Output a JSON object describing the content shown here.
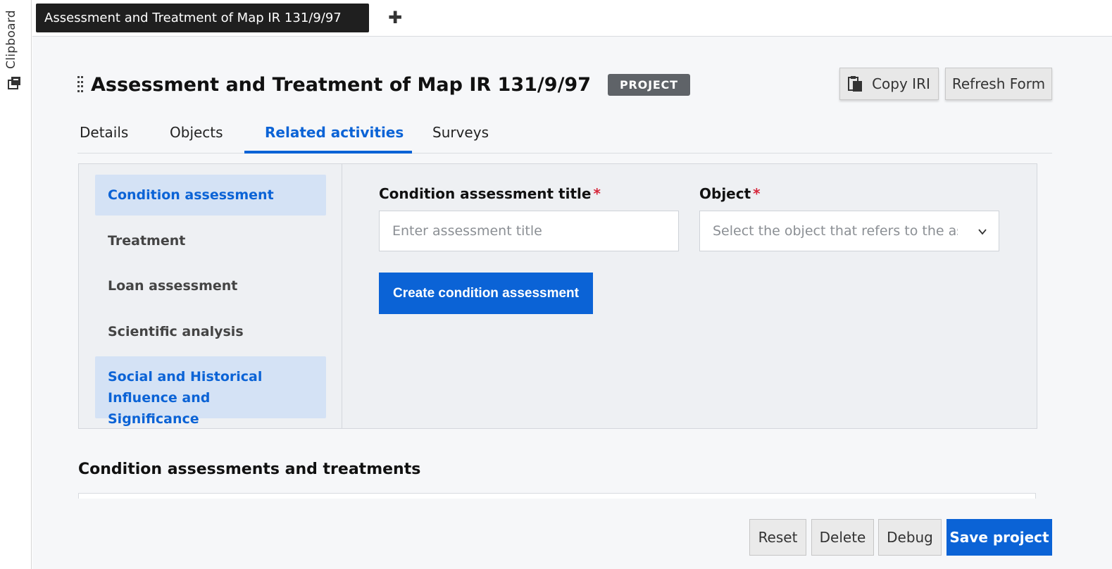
{
  "clipboard": {
    "label": "Clipboard",
    "icon": "clipboard-stack-icon"
  },
  "doc_tab": {
    "label": "Assessment and Treatment of Map IR 131/9/97",
    "add_icon": "plus-icon",
    "add_glyph": "✚"
  },
  "header": {
    "title": "Assessment and Treatment of Map IR 131/9/97",
    "badge": "PROJECT",
    "copy_iri_label": "Copy IRI",
    "refresh_label": "Refresh Form"
  },
  "tabs": [
    {
      "label": "Details",
      "active": false
    },
    {
      "label": "Objects",
      "active": false
    },
    {
      "label": "Related activities",
      "active": true
    },
    {
      "label": "Surveys",
      "active": false
    }
  ],
  "activities": [
    {
      "label": "Condition assessment",
      "selected": true
    },
    {
      "label": "Treatment",
      "selected": false
    },
    {
      "label": "Loan assessment",
      "selected": false
    },
    {
      "label": "Scientific analysis",
      "selected": false
    },
    {
      "label": "Social and Historical Influence and Significance",
      "selected": true
    }
  ],
  "form": {
    "title_label": "Condition assessment title",
    "title_placeholder": "Enter assessment title",
    "object_label": "Object",
    "object_placeholder": "Select the object that refers to the as",
    "required_mark": "*",
    "create_label": "Create condition assessment"
  },
  "section": {
    "title": "Condition assessments and treatments"
  },
  "footer": {
    "reset": "Reset",
    "delete": "Delete",
    "debug": "Debug",
    "save": "Save project"
  },
  "colors": {
    "accent": "#0b63d6",
    "badge": "#5f6368",
    "required": "#d6263a",
    "selected_bg": "#d4e2f5"
  }
}
